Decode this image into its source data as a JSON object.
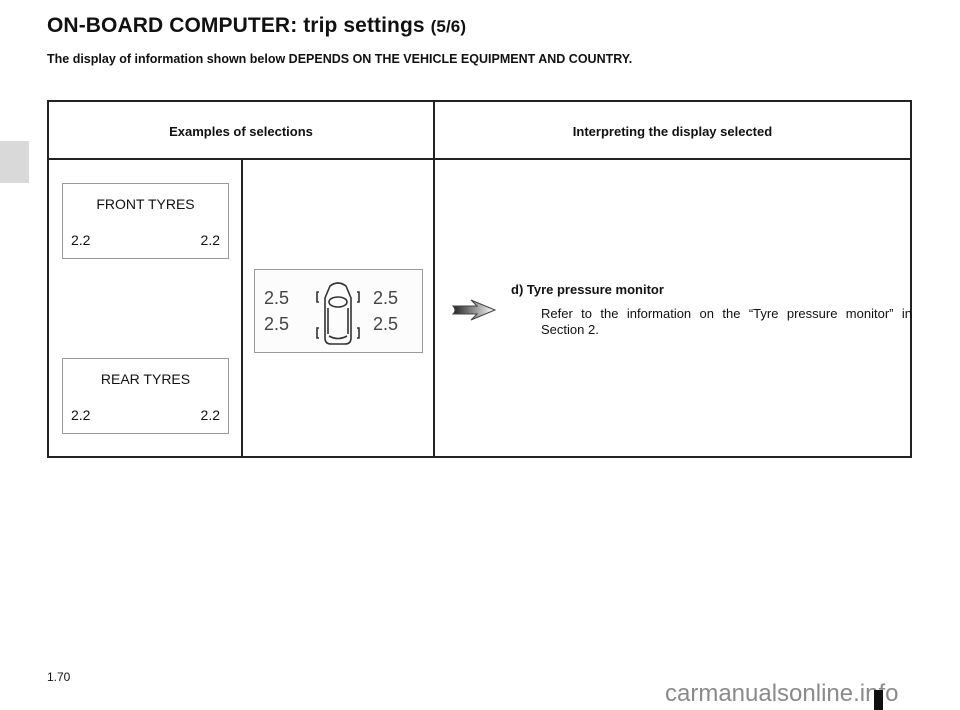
{
  "header": {
    "title": "ON-BOARD COMPUTER: trip settings",
    "page_indicator": "(5/6)",
    "subtitle": "The display of information shown below DEPENDS ON THE VEHICLE EQUIPMENT AND COUNTRY."
  },
  "table": {
    "columns": [
      "Examples of selections",
      "Interpreting the display selected"
    ],
    "front_display": {
      "label": "FRONT TYRES",
      "left": "2.2",
      "right": "2.2"
    },
    "rear_display": {
      "label": "REAR TYRES",
      "left": "2.2",
      "right": "2.2"
    },
    "car_display": {
      "front_left": "2.5",
      "front_right": "2.5",
      "rear_left": "2.5",
      "rear_right": "2.5"
    },
    "item": {
      "title": "d) Tyre pressure monitor",
      "body": "Refer to the information on the “Tyre pressure monitor” in Section 2."
    }
  },
  "footer": {
    "page_number": "1.70",
    "watermark": "carmanualsonline.info"
  }
}
